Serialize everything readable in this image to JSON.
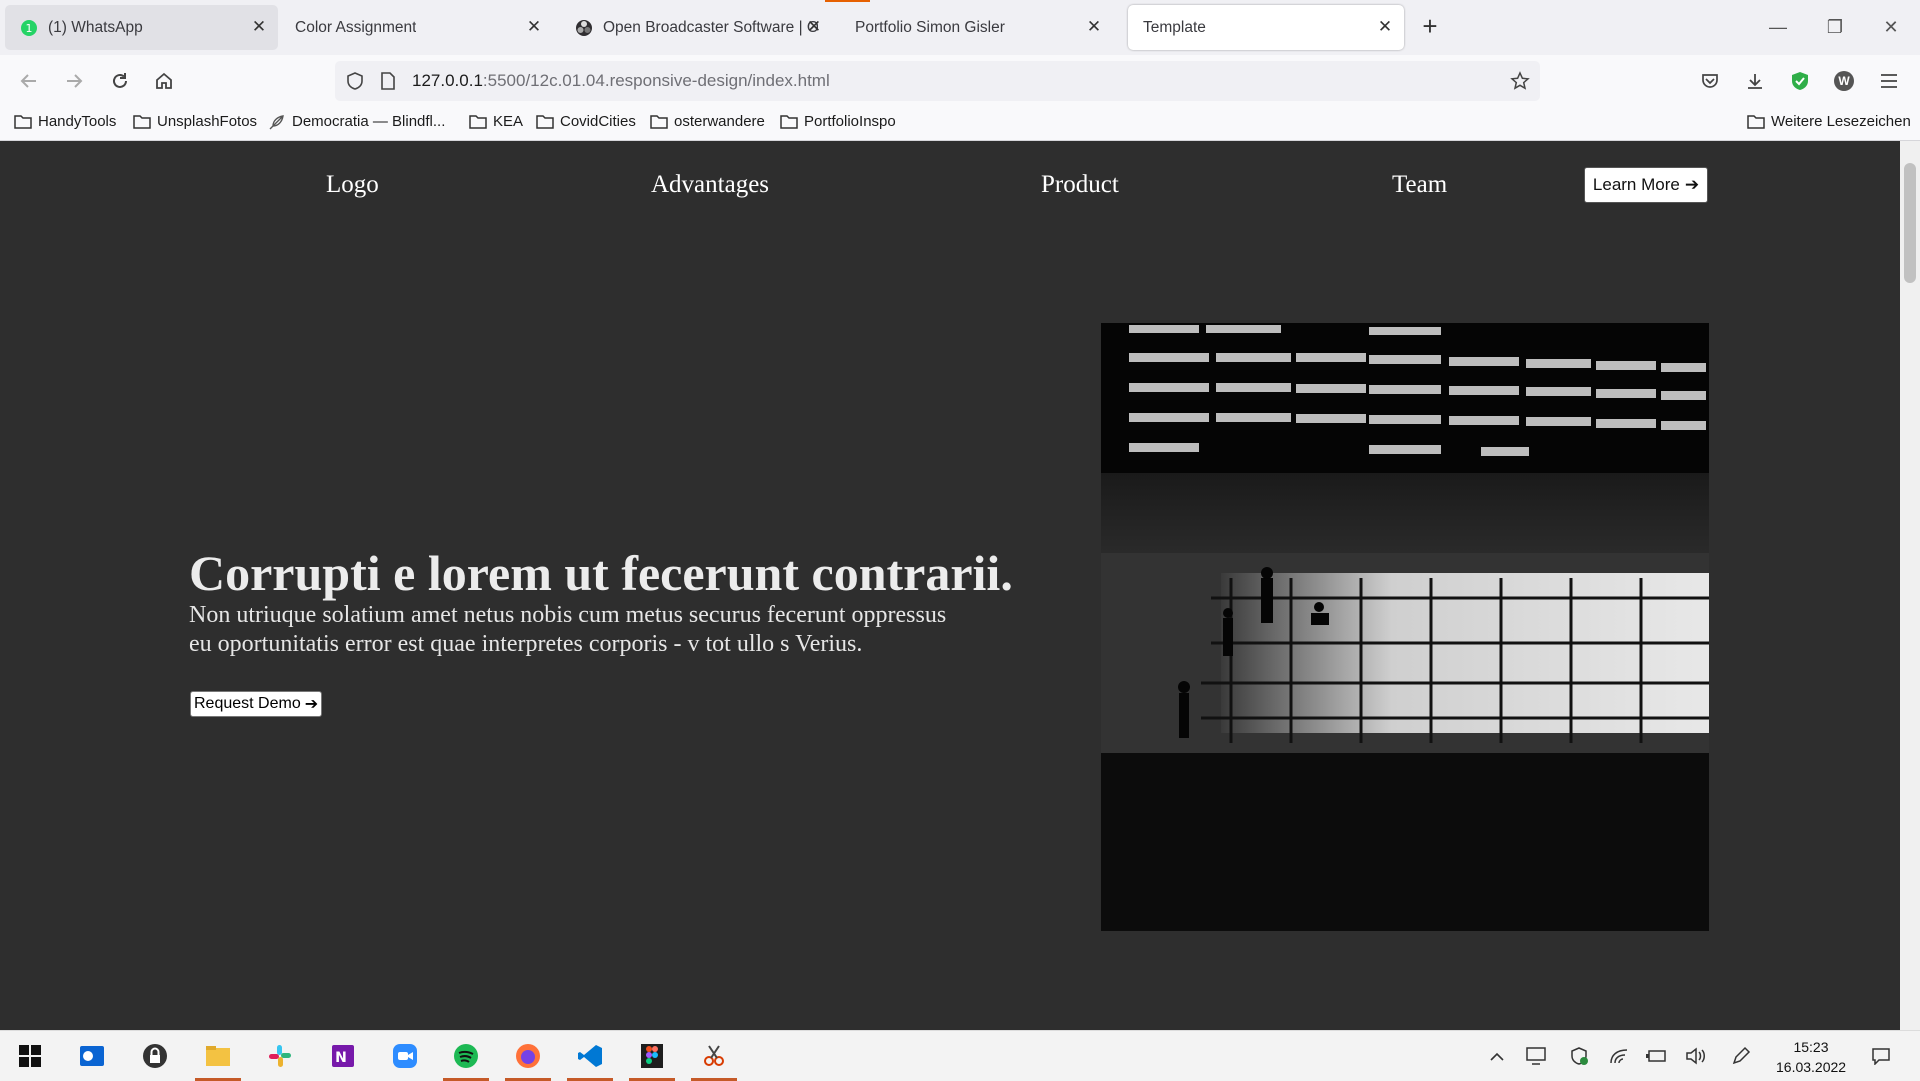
{
  "browser": {
    "tabs": [
      {
        "title": "(1) WhatsApp",
        "icon": "whatsapp-icon"
      },
      {
        "title": "Color Assignment",
        "icon": ""
      },
      {
        "title": "Open Broadcaster Software | OBS",
        "icon": "obs-icon"
      },
      {
        "title": "Portfolio Simon Gisler",
        "icon": ""
      },
      {
        "title": "Template",
        "icon": "",
        "active": true
      }
    ],
    "url": {
      "host": "127.0.0.1",
      "rest": ":5500/12c.01.04.responsive-design/index.html"
    },
    "bookmarks": [
      {
        "label": "HandyTools",
        "icon": "folder-icon"
      },
      {
        "label": "UnsplashFotos",
        "icon": "folder-icon"
      },
      {
        "label": "Democratia — Blindfl...",
        "icon": "feather-icon"
      },
      {
        "label": "KEA",
        "icon": "folder-icon"
      },
      {
        "label": "CovidCities",
        "icon": "folder-icon"
      },
      {
        "label": "osterwandere",
        "icon": "folder-icon"
      },
      {
        "label": "PortfolioInspo",
        "icon": "folder-icon"
      }
    ],
    "other_bookmarks": "Weitere Lesezeichen",
    "profile_initial": "W"
  },
  "site": {
    "nav": {
      "logo": "Logo",
      "advantages": "Advantages",
      "product": "Product",
      "team": "Team"
    },
    "learn_more": "Learn More",
    "hero": {
      "title": "Corrupti e lorem ut fecerunt contrarii.",
      "body": "Non utriuque solatium amet netus nobis cum metus securus fecerunt oppressus eu oportunitatis error est quae interpretes corporis - v tot ullo s Verius.",
      "cta": "Request Demo"
    },
    "arrow": "➔"
  },
  "taskbar": {
    "apps": [
      "windows-start-icon",
      "outlook-icon",
      "lock-app-icon",
      "file-explorer-icon",
      "slack-icon",
      "onenote-icon",
      "zoom-icon",
      "spotify-icon",
      "firefox-icon",
      "vscode-icon",
      "figma-icon",
      "snipping-tool-icon"
    ],
    "time": "15:23",
    "date": "16.03.2022"
  },
  "colors": {
    "page_bg": "#2e2e2e",
    "tab_accent": "#e66000",
    "running_indicator": "#c55a28"
  }
}
